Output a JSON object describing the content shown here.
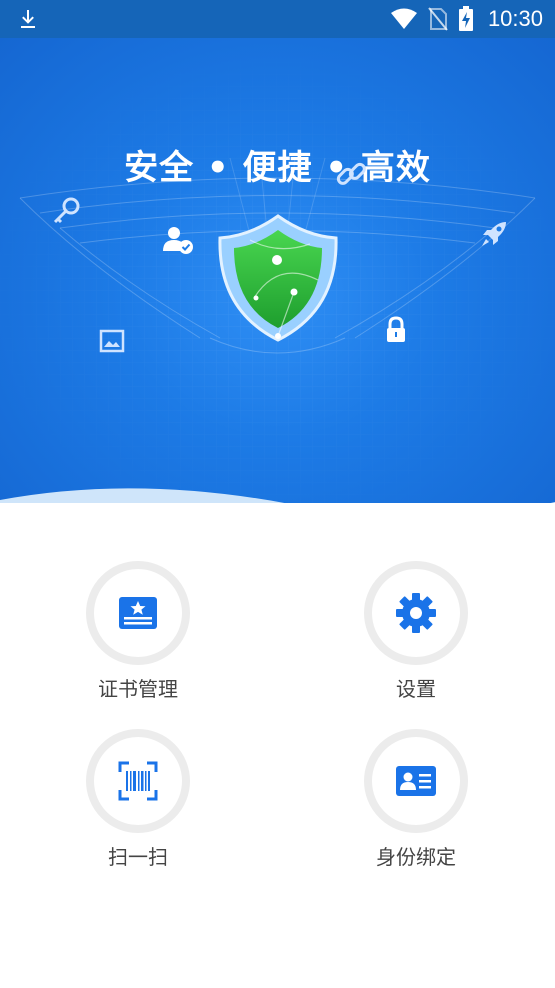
{
  "status_bar": {
    "time": "10:30",
    "icons": [
      "download-icon",
      "wifi-icon",
      "no-sim-icon",
      "battery-charging-icon"
    ]
  },
  "hero": {
    "slogan": "安全 • 便捷 • 高效",
    "icons": [
      "key-icon",
      "link-icon",
      "user-verified-icon",
      "rocket-icon",
      "picture-icon",
      "lock-icon",
      "shield-icon"
    ]
  },
  "menu": {
    "items": [
      {
        "label": "证书管理",
        "icon": "certificate-icon"
      },
      {
        "label": "设置",
        "icon": "gear-icon"
      },
      {
        "label": "扫一扫",
        "icon": "barcode-scan-icon"
      },
      {
        "label": "身份绑定",
        "icon": "id-card-icon"
      }
    ]
  },
  "colors": {
    "primary": "#1d7be6",
    "status_bar": "#1565b8",
    "icon_blue": "#1a73e8",
    "shield_green": "#2dbb3a"
  }
}
